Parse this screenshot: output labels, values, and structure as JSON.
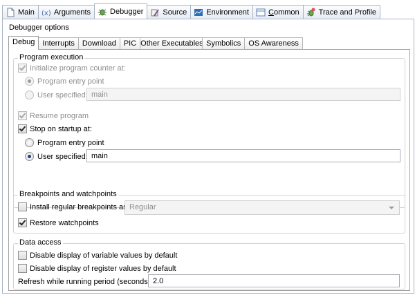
{
  "top_tabs": [
    {
      "label": "Main",
      "icon": "document-icon"
    },
    {
      "label": "Arguments",
      "icon": "arguments-icon"
    },
    {
      "label": "Debugger",
      "icon": "debugger-icon"
    },
    {
      "label": "Source",
      "icon": "source-icon"
    },
    {
      "label": "Environment",
      "icon": "environment-icon"
    },
    {
      "label_prefix": "",
      "label_underlined": "C",
      "label_rest": "ommon",
      "icon": "common-icon"
    },
    {
      "label": "Trace and Profile",
      "icon": "trace-icon"
    }
  ],
  "active_top_tab": "Debugger",
  "debugger_options_label": "Debugger options",
  "inner_tabs": [
    "Debug",
    "Interrupts",
    "Download",
    "PIC",
    "Other Executables",
    "Symbolics",
    "OS Awareness"
  ],
  "active_inner_tab": "Debug",
  "program_execution": {
    "title": "Program execution",
    "init_pc_label": "Initialize program counter at:",
    "init_pc_checked": true,
    "init_pc_enabled": false,
    "entry_point_label": "Program entry point",
    "user_specified_label": "User specified:",
    "init_pc_user_value": "main",
    "resume_label": "Resume program",
    "stop_on_startup_label": "Stop on startup at:",
    "stop_entry_label": "Program entry point",
    "stop_user_label": "User specified:",
    "stop_user_value": "main"
  },
  "breakpoints": {
    "title": "Breakpoints and watchpoints",
    "install_label": "Install regular breakpoints as",
    "install_value": "Regular",
    "restore_label": "Restore watchpoints"
  },
  "data_access": {
    "title": "Data access",
    "disable_var_label": "Disable display of variable values by default",
    "disable_reg_label": "Disable display of register values by default",
    "refresh_label": "Refresh while running period (seconds):",
    "refresh_value": "2.0"
  }
}
